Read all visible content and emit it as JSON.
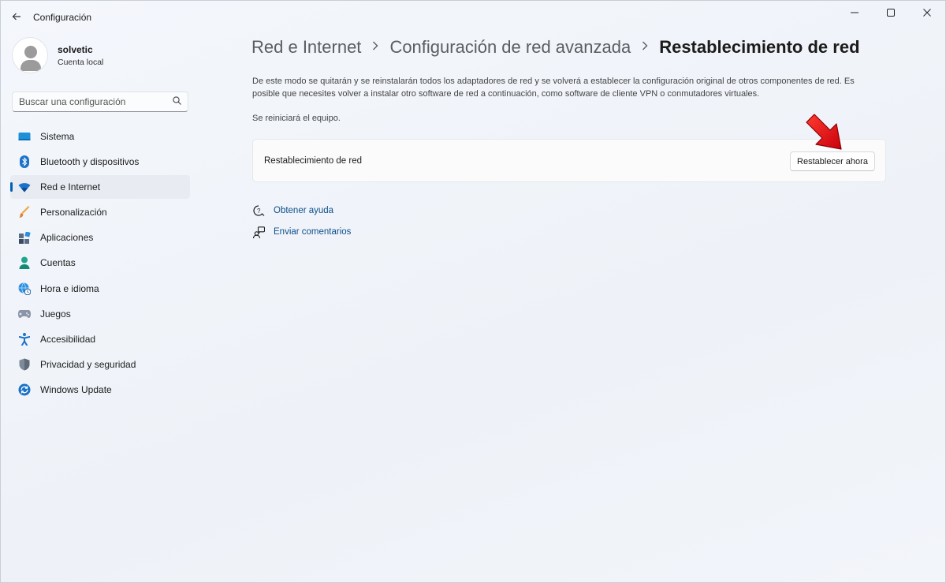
{
  "window": {
    "app_title": "Configuración",
    "controls": {
      "minimize": "—",
      "maximize": "☐",
      "close": "✕"
    }
  },
  "user": {
    "name": "solvetic",
    "account_type": "Cuenta local"
  },
  "search": {
    "placeholder": "Buscar una configuración"
  },
  "sidebar": {
    "items": [
      {
        "label": "Sistema",
        "icon": "display-icon",
        "active": false
      },
      {
        "label": "Bluetooth y dispositivos",
        "icon": "bluetooth-icon",
        "active": false
      },
      {
        "label": "Red e Internet",
        "icon": "wifi-icon",
        "active": true
      },
      {
        "label": "Personalización",
        "icon": "brush-icon",
        "active": false
      },
      {
        "label": "Aplicaciones",
        "icon": "apps-icon",
        "active": false
      },
      {
        "label": "Cuentas",
        "icon": "person-icon",
        "active": false
      },
      {
        "label": "Hora e idioma",
        "icon": "globe-clock-icon",
        "active": false
      },
      {
        "label": "Juegos",
        "icon": "gamepad-icon",
        "active": false
      },
      {
        "label": "Accesibilidad",
        "icon": "accessibility-icon",
        "active": false
      },
      {
        "label": "Privacidad y seguridad",
        "icon": "shield-icon",
        "active": false
      },
      {
        "label": "Windows Update",
        "icon": "update-icon",
        "active": false
      }
    ]
  },
  "breadcrumb": {
    "items": [
      "Red e Internet",
      "Configuración de red avanzada",
      "Restablecimiento de red"
    ]
  },
  "main": {
    "description": "De este modo se quitarán y se reinstalarán todos los adaptadores de red y se volverá a establecer la configuración original de otros componentes de red. Es posible que necesites volver a instalar otro software de red a continuación, como software de cliente VPN o conmutadores virtuales.",
    "restart_note": "Se reiniciará el equipo.",
    "card": {
      "label": "Restablecimiento de red",
      "button_label": "Restablecer ahora"
    },
    "links": {
      "help": "Obtener ayuda",
      "feedback": "Enviar comentarios"
    }
  },
  "colors": {
    "accent": "#005fb8",
    "link": "#0b4f8a",
    "annotation_arrow": "#e8121a"
  }
}
